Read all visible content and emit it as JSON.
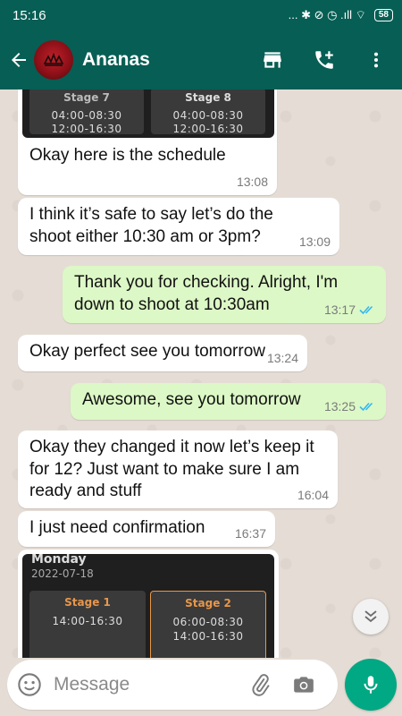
{
  "status_bar": {
    "time": "15:16",
    "icons_text": "... ✱ ⊘ ◷ .ıll ⌔",
    "battery": "58"
  },
  "header": {
    "contact_name": "Ananas",
    "icons": [
      "back-arrow-icon",
      "store-icon",
      "add-call-icon",
      "more-vert-icon"
    ]
  },
  "schedule_top": {
    "stage_a": {
      "title": "Stage 7",
      "lines": [
        "04:00-08:30",
        "12:00-16:30"
      ]
    },
    "stage_b": {
      "title": "Stage 8",
      "lines": [
        "04:00-08:30",
        "12:00-16:30"
      ]
    }
  },
  "messages": [
    {
      "dir": "in",
      "text": "Okay here is the schedule",
      "time": "13:08"
    },
    {
      "dir": "in",
      "text_lines": [
        "I think it’s safe to say let’s do the",
        "shoot either 10:30 am or 3pm?"
      ],
      "time": "13:09"
    },
    {
      "dir": "out",
      "text_lines": [
        "Thank you for checking. Alright, I'm",
        "down to shoot at 10:30am"
      ],
      "time": "13:17",
      "read": true
    },
    {
      "dir": "in",
      "text": "Okay perfect see you tomorrow",
      "time": "13:24"
    },
    {
      "dir": "out",
      "text": "Awesome, see you tomorrow",
      "time": "13:25",
      "read": true
    },
    {
      "dir": "in",
      "text_lines": [
        "Okay they changed it now let’s keep it",
        "for 12? Just want to make sure I am",
        "ready and stuff"
      ],
      "time": "16:04"
    },
    {
      "dir": "in",
      "text": "I just need confirmation",
      "time": "16:37"
    }
  ],
  "schedule_bottom": {
    "day": "Monday",
    "date": "2022-07-18",
    "stage_a": {
      "title": "Stage 1",
      "lines": [
        "14:00-16:30"
      ]
    },
    "stage_b": {
      "title": "Stage 2",
      "lines": [
        "06:00-08:30",
        "14:00-16:30"
      ]
    }
  },
  "input": {
    "placeholder": "Message"
  },
  "colors": {
    "header": "#075e54",
    "outgoing_bubble": "#dcf8c6",
    "incoming_bubble": "#ffffff",
    "mic_button": "#00a884",
    "read_ticks": "#34b7f1",
    "stage_highlight": "#e8964a"
  }
}
